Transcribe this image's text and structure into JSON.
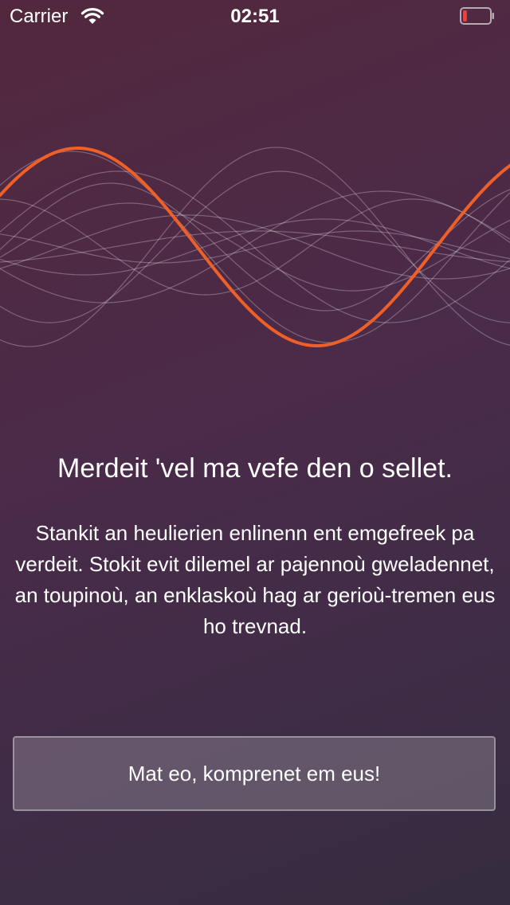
{
  "status_bar": {
    "carrier": "Carrier",
    "time": "02:51",
    "battery_level": 0.15,
    "battery_color": "#ff3b30"
  },
  "onboarding": {
    "title": "Merdeit 'vel ma vefe den o sellet.",
    "body": "Stankit an heulierien enlinenn ent emgefreek pa verdeit. Stokit evit dilemel ar pajennoù gweladennet, an toupinoù, an enklaskoù hag ar gerioù-tremen eus ho trevnad.",
    "button_label": "Mat eo, komprenet em eus!",
    "accent_color": "#ef5f28"
  }
}
